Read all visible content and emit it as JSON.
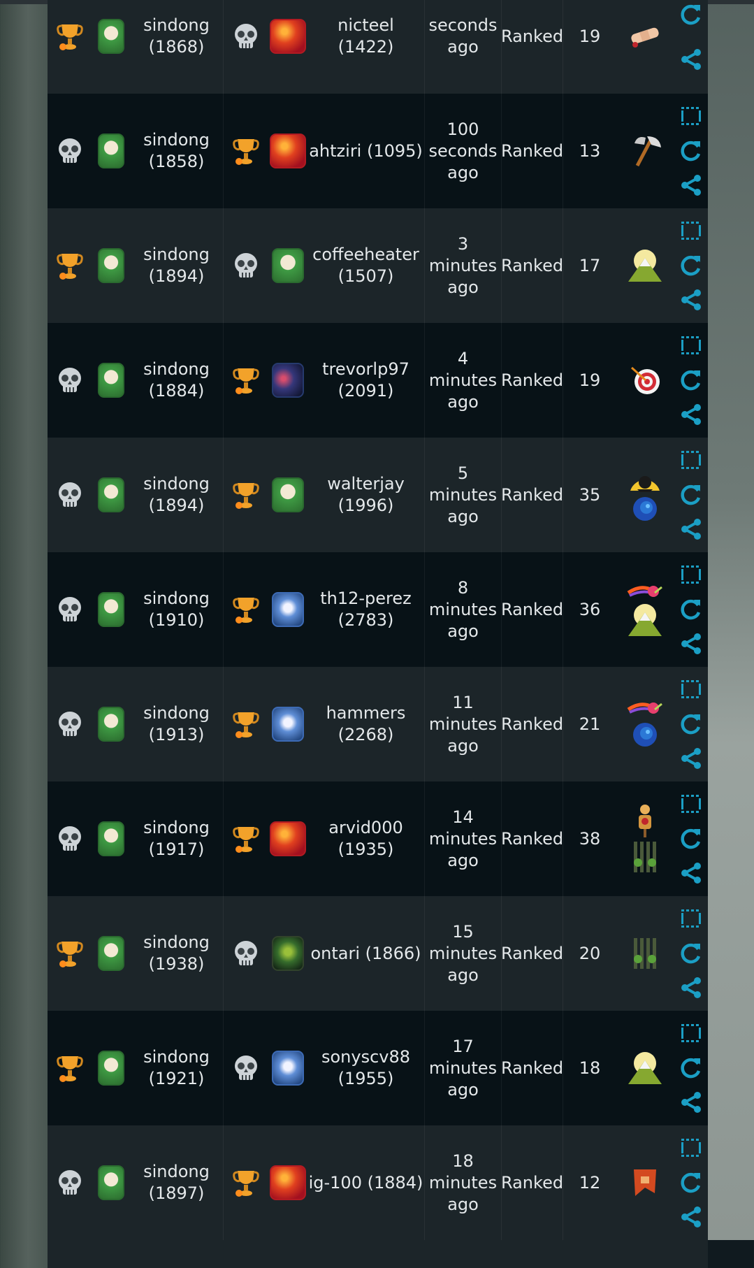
{
  "rows": [
    {
      "p1_result": "win",
      "p1_icon": "trophy-icon",
      "p1_avatar": "green",
      "p1_name": "sindong",
      "p1_rating": "(1868)",
      "p2_result": "loss",
      "p2_icon": "skull-icon",
      "p2_avatar": "red",
      "p2_label": "nicteel (1422)",
      "time": [
        "",
        "seconds",
        "ago"
      ],
      "mode": "Ranked",
      "turns": "19",
      "items": [
        "bandage-icon"
      ],
      "actions": [
        "refresh-icon",
        "share-icon"
      ]
    },
    {
      "p1_result": "loss",
      "p1_icon": "skull-icon",
      "p1_avatar": "green",
      "p1_name": "sindong",
      "p1_rating": "(1858)",
      "p2_result": "win",
      "p2_icon": "trophy-icon",
      "p2_avatar": "red",
      "p2_label": "ahtziri (1095)",
      "time": [
        "100",
        "seconds",
        "ago"
      ],
      "mode": "Ranked",
      "turns": "13",
      "items": [
        "axe-icon"
      ],
      "actions": [
        "replay-icon",
        "refresh-icon",
        "share-icon"
      ]
    },
    {
      "p1_result": "win",
      "p1_icon": "trophy-icon",
      "p1_avatar": "green",
      "p1_name": "sindong",
      "p1_rating": "(1894)",
      "p2_result": "loss",
      "p2_icon": "skull-icon",
      "p2_avatar": "green",
      "p2_label": "coffeeheater (1507)",
      "time": [
        "3",
        "minutes",
        "ago"
      ],
      "mode": "Ranked",
      "turns": "17",
      "items": [
        "mountain-icon"
      ],
      "actions": [
        "replay-icon",
        "refresh-icon",
        "share-icon"
      ]
    },
    {
      "p1_result": "loss",
      "p1_icon": "skull-icon",
      "p1_avatar": "green",
      "p1_name": "sindong",
      "p1_rating": "(1884)",
      "p2_result": "win",
      "p2_icon": "trophy-icon",
      "p2_avatar": "dark",
      "p2_label": "trevorlp97 (2091)",
      "time": [
        "4",
        "minutes",
        "ago"
      ],
      "mode": "Ranked",
      "turns": "19",
      "items": [
        "target-icon"
      ],
      "actions": [
        "replay-icon",
        "refresh-icon",
        "share-icon"
      ]
    },
    {
      "p1_result": "loss",
      "p1_icon": "skull-icon",
      "p1_avatar": "green",
      "p1_name": "sindong",
      "p1_rating": "(1894)",
      "p2_result": "win",
      "p2_icon": "trophy-icon",
      "p2_avatar": "green",
      "p2_label": "walterjay (1996)",
      "time": [
        "5",
        "minutes",
        "ago"
      ],
      "mode": "Ranked",
      "turns": "35",
      "items": [
        "eclipse-icon",
        "vortex-icon"
      ],
      "actions": [
        "replay-icon",
        "refresh-icon",
        "share-icon"
      ]
    },
    {
      "p1_result": "loss",
      "p1_icon": "skull-icon",
      "p1_avatar": "green",
      "p1_name": "sindong",
      "p1_rating": "(1910)",
      "p2_result": "win",
      "p2_icon": "trophy-icon",
      "p2_avatar": "blue",
      "p2_label": "th12-perez (2783)",
      "time": [
        "8",
        "minutes",
        "ago"
      ],
      "mode": "Ranked",
      "turns": "36",
      "items": [
        "comet-icon",
        "mountain-icon"
      ],
      "actions": [
        "replay-icon",
        "refresh-icon",
        "share-icon"
      ]
    },
    {
      "p1_result": "loss",
      "p1_icon": "skull-icon",
      "p1_avatar": "green",
      "p1_name": "sindong",
      "p1_rating": "(1913)",
      "p2_result": "win",
      "p2_icon": "trophy-icon",
      "p2_avatar": "blue",
      "p2_label": "hammers (2268)",
      "time": [
        "11",
        "minutes",
        "ago"
      ],
      "mode": "Ranked",
      "turns": "21",
      "items": [
        "comet-icon",
        "vortex-icon"
      ],
      "actions": [
        "replay-icon",
        "refresh-icon",
        "share-icon"
      ]
    },
    {
      "p1_result": "loss",
      "p1_icon": "skull-icon",
      "p1_avatar": "green",
      "p1_name": "sindong",
      "p1_rating": "(1917)",
      "p2_result": "win",
      "p2_icon": "trophy-icon",
      "p2_avatar": "red",
      "p2_label": "arvid000 (1935)",
      "time": [
        "14",
        "minutes",
        "ago"
      ],
      "mode": "Ranked",
      "turns": "38",
      "items": [
        "dummy-icon",
        "cage-icon"
      ],
      "actions": [
        "replay-icon",
        "refresh-icon",
        "share-icon"
      ]
    },
    {
      "p1_result": "win",
      "p1_icon": "trophy-icon",
      "p1_avatar": "green",
      "p1_name": "sindong",
      "p1_rating": "(1938)",
      "p2_result": "loss",
      "p2_icon": "skull-icon",
      "p2_avatar": "goblin",
      "p2_label": "ontari (1866)",
      "time": [
        "15",
        "minutes",
        "ago"
      ],
      "mode": "Ranked",
      "turns": "20",
      "items": [
        "cage-icon"
      ],
      "actions": [
        "replay-icon",
        "refresh-icon",
        "share-icon"
      ]
    },
    {
      "p1_result": "win",
      "p1_icon": "trophy-icon",
      "p1_avatar": "green",
      "p1_name": "sindong",
      "p1_rating": "(1921)",
      "p2_result": "loss",
      "p2_icon": "skull-icon",
      "p2_avatar": "blue",
      "p2_label": "sonyscv88 (1955)",
      "time": [
        "17",
        "minutes",
        "ago"
      ],
      "mode": "Ranked",
      "turns": "18",
      "items": [
        "mountain-icon"
      ],
      "actions": [
        "replay-icon",
        "refresh-icon",
        "share-icon"
      ]
    },
    {
      "p1_result": "loss",
      "p1_icon": "skull-icon",
      "p1_avatar": "green",
      "p1_name": "sindong",
      "p1_rating": "(1897)",
      "p2_result": "win",
      "p2_icon": "trophy-icon",
      "p2_avatar": "red",
      "p2_label": "ig-100 (1884)",
      "time": [
        "18",
        "minutes",
        "ago"
      ],
      "mode": "Ranked",
      "turns": "12",
      "items": [
        "banner-icon"
      ],
      "actions": [
        "replay-icon",
        "refresh-icon",
        "share-icon"
      ]
    }
  ],
  "colors": {
    "accent_icon": "#1b9fc5",
    "trophy": "#f2a22a",
    "skull": "#c9cfd3"
  }
}
